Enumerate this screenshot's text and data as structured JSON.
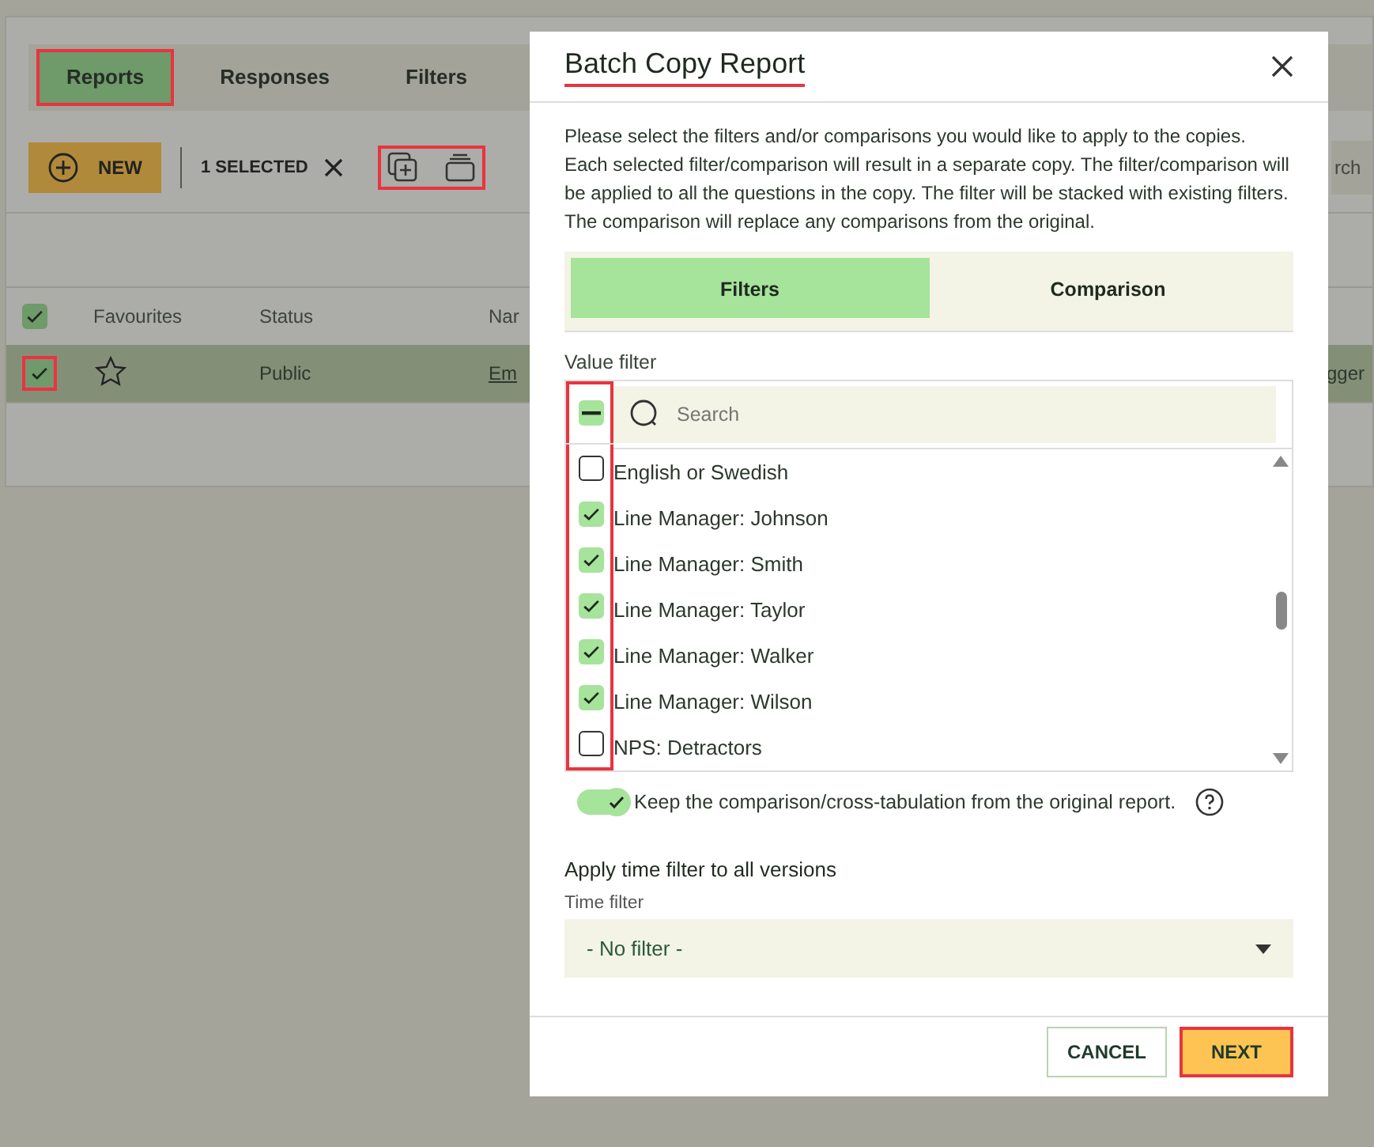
{
  "tabs": [
    {
      "label": "Reports",
      "selected": true,
      "highlighted": true
    },
    {
      "label": "Responses",
      "selected": false,
      "highlighted": false
    },
    {
      "label": "Filters",
      "selected": false,
      "highlighted": false
    }
  ],
  "toolbar": {
    "new_button": "NEW",
    "selection_count": "1 SELECTED",
    "action_icons_highlighted": true,
    "search_partial": "rch"
  },
  "table": {
    "header_checked": true,
    "columns": [
      "Favourites",
      "Status",
      "Nar"
    ],
    "rows": [
      {
        "selected": true,
        "checked": true,
        "highlighted": true,
        "favourite": false,
        "status": "Public",
        "name": "Em",
        "column_4": "gger"
      }
    ]
  },
  "dialog": {
    "title": "Batch Copy Report",
    "title_underlined": true,
    "description": "Please select the filters and/or comparisons you would like to apply to the copies. Each selected filter/comparison will result in a separate copy. The filter/comparison will be applied to all the questions in the copy. The filter will be stacked with existing filters. The comparison will replace any comparisons from the original.",
    "tabs": [
      {
        "label": "Filters",
        "selected": true
      },
      {
        "label": "Comparison",
        "selected": false
      }
    ],
    "value_filter": {
      "label": "Value filter",
      "select_all_indeterminate": true,
      "checkbox_column_highlighted": true,
      "search_placeholder": "Search",
      "items": [
        {
          "label": "English or Swedish",
          "checked": false
        },
        {
          "label": "Line Manager: Johnson",
          "checked": true
        },
        {
          "label": "Line Manager: Smith",
          "checked": true
        },
        {
          "label": "Line Manager: Taylor",
          "checked": true
        },
        {
          "label": "Line Manager: Walker",
          "checked": true
        },
        {
          "label": "Line Manager: Wilson",
          "checked": true
        },
        {
          "label": "NPS: Detractors",
          "checked": false
        }
      ]
    },
    "keep_toggle": {
      "label": "Keep the comparison/cross-tabulation from the original report.",
      "on": true
    },
    "time_filter": {
      "heading": "Apply time filter to all versions",
      "label": "Time filter",
      "value": "- No filter -"
    },
    "buttons": [
      {
        "label": "CANCEL",
        "kind": "secondary",
        "highlighted": false
      },
      {
        "label": "NEXT",
        "kind": "primary",
        "highlighted": true
      }
    ]
  }
}
